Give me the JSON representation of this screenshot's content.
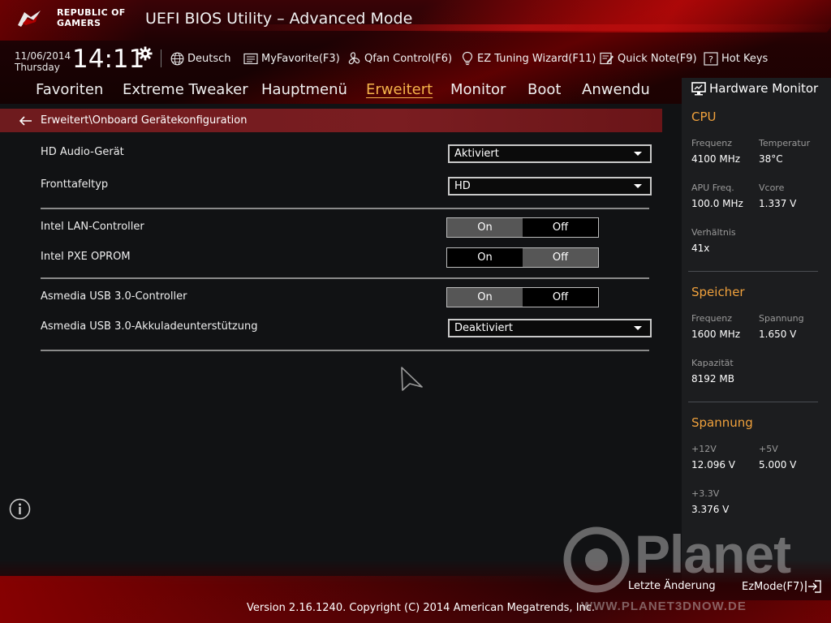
{
  "brand": {
    "line1": "REPUBLIC OF",
    "line2": "GAMERS"
  },
  "app_title": "UEFI BIOS Utility – Advanced Mode",
  "datetime": {
    "date": "11/06/2014",
    "day": "Thursday",
    "time": "14:11"
  },
  "toolbar": {
    "language": "Deutsch",
    "my_favorite": "MyFavorite(F3)",
    "qfan": "Qfan Control(F6)",
    "ez_tuning": "EZ Tuning Wizard(F11)",
    "quick_note": "Quick Note(F9)",
    "hot_keys": "Hot Keys"
  },
  "tabs": [
    "Favoriten",
    "Extreme Tweaker",
    "Hauptmenü",
    "Erweitert",
    "Monitor",
    "Boot",
    "Anwendu"
  ],
  "active_tab": "Erweitert",
  "breadcrumb": "Erweitert\\Onboard Gerätekonfiguration",
  "settings": {
    "hd_audio": {
      "label": "HD Audio-Gerät",
      "value": "Aktiviert"
    },
    "front_panel": {
      "label": "Fronttafeltyp",
      "value": "HD"
    },
    "intel_lan": {
      "label": "Intel LAN-Controller",
      "on": "On",
      "off": "Off",
      "selected": "On"
    },
    "intel_pxe": {
      "label": "Intel PXE OPROM",
      "on": "On",
      "off": "Off",
      "selected": "Off"
    },
    "asmedia_usb": {
      "label": "Asmedia USB 3.0-Controller",
      "on": "On",
      "off": "Off",
      "selected": "On"
    },
    "asmedia_charging": {
      "label": "Asmedia USB 3.0-Akkuladeunterstützung",
      "value": "Deaktiviert"
    }
  },
  "hardware_monitor": {
    "title": "Hardware Monitor",
    "cpu": {
      "title": "CPU",
      "freq_label": "Frequenz",
      "freq_value": "4100 MHz",
      "temp_label": "Temperatur",
      "temp_value": "38°C",
      "apu_label": "APU Freq.",
      "apu_value": "100.0 MHz",
      "vcore_label": "Vcore",
      "vcore_value": "1.337 V",
      "ratio_label": "Verhältnis",
      "ratio_value": "41x"
    },
    "memory": {
      "title": "Speicher",
      "freq_label": "Frequenz",
      "freq_value": "1600 MHz",
      "volt_label": "Spannung",
      "volt_value": "1.650 V",
      "cap_label": "Kapazität",
      "cap_value": "8192 MB"
    },
    "voltage": {
      "title": "Spannung",
      "v12_label": "+12V",
      "v12_value": "12.096 V",
      "v5_label": "+5V",
      "v5_value": "5.000 V",
      "v33_label": "+3.3V",
      "v33_value": "3.376 V"
    }
  },
  "footer": {
    "last_change": "Letzte Änderung",
    "ezmode": "EzMode(F7)",
    "version": "Version 2.16.1240. Copyright (C) 2014 American Megatrends, Inc."
  },
  "watermark": {
    "text": "Planet",
    "sub": "WWW.PLANET3DNOW.DE"
  },
  "colors": {
    "accent": "#f0a13c",
    "active_tab": "#f6b44b",
    "breadcrumb_bg": "#7a1d21",
    "toggle_selected": "#565656"
  },
  "icons": [
    "rog-logo",
    "gear-icon",
    "globe-icon",
    "favorite-icon",
    "fan-icon",
    "bulb-icon",
    "note-icon",
    "help-icon",
    "back-arrow-icon",
    "monitor-icon",
    "info-icon",
    "exit-icon"
  ]
}
